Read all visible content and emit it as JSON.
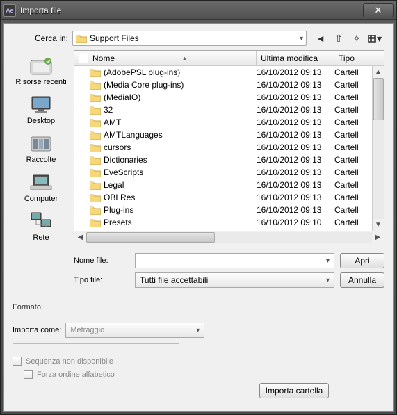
{
  "title": "Importa file",
  "topbar": {
    "lookin_label": "Cerca in:",
    "lookin_value": "Support Files"
  },
  "places": [
    {
      "label": "Risorse recenti"
    },
    {
      "label": "Desktop"
    },
    {
      "label": "Raccolte"
    },
    {
      "label": "Computer"
    },
    {
      "label": "Rete"
    }
  ],
  "columns": {
    "name": "Nome",
    "date": "Ultima modifica",
    "type": "Tipo"
  },
  "rows": [
    {
      "name": "(AdobePSL plug-ins)",
      "date": "16/10/2012 09:13",
      "type": "Cartell"
    },
    {
      "name": "(Media Core plug-ins)",
      "date": "16/10/2012 09:13",
      "type": "Cartell"
    },
    {
      "name": "(MediaIO)",
      "date": "16/10/2012 09:13",
      "type": "Cartell"
    },
    {
      "name": "32",
      "date": "16/10/2012 09:13",
      "type": "Cartell"
    },
    {
      "name": "AMT",
      "date": "16/10/2012 09:13",
      "type": "Cartell"
    },
    {
      "name": "AMTLanguages",
      "date": "16/10/2012 09:13",
      "type": "Cartell"
    },
    {
      "name": "cursors",
      "date": "16/10/2012 09:13",
      "type": "Cartell"
    },
    {
      "name": "Dictionaries",
      "date": "16/10/2012 09:13",
      "type": "Cartell"
    },
    {
      "name": "EveScripts",
      "date": "16/10/2012 09:13",
      "type": "Cartell"
    },
    {
      "name": "Legal",
      "date": "16/10/2012 09:13",
      "type": "Cartell"
    },
    {
      "name": "OBLRes",
      "date": "16/10/2012 09:13",
      "type": "Cartell"
    },
    {
      "name": "Plug-ins",
      "date": "16/10/2012 09:13",
      "type": "Cartell"
    },
    {
      "name": "Presets",
      "date": "16/10/2012 09:10",
      "type": "Cartell"
    }
  ],
  "fields": {
    "nome_label": "Nome file:",
    "nome_value": "",
    "tipo_label": "Tipo file:",
    "tipo_value": "Tutti file accettabili",
    "open": "Apri",
    "cancel": "Annulla"
  },
  "bottom": {
    "formato_label": "Formato:",
    "importa_label": "Importa come:",
    "importa_value": "Metraggio",
    "seq_label": "Sequenza non disponibile",
    "forza_label": "Forza ordine alfabetico",
    "importa_cartella": "Importa cartella"
  }
}
